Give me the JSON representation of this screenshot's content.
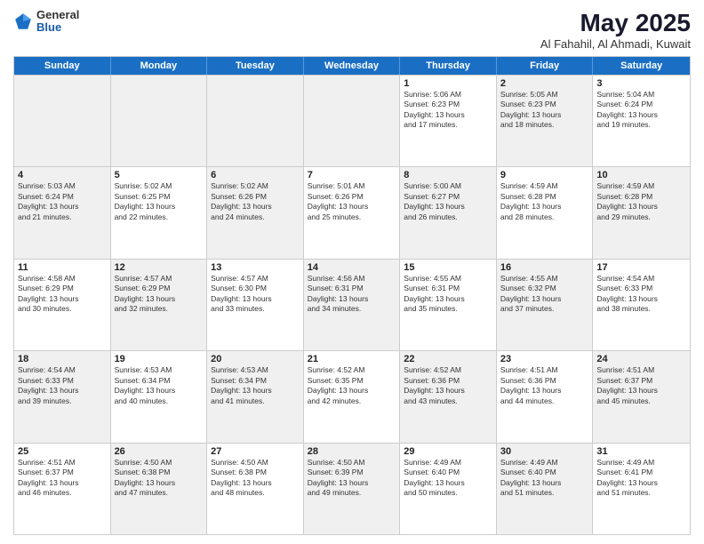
{
  "logo": {
    "general": "General",
    "blue": "Blue"
  },
  "title": "May 2025",
  "subtitle": "Al Fahahil, Al Ahmadi, Kuwait",
  "header_days": [
    "Sunday",
    "Monday",
    "Tuesday",
    "Wednesday",
    "Thursday",
    "Friday",
    "Saturday"
  ],
  "weeks": [
    [
      {
        "day": "",
        "text": "",
        "shaded": true
      },
      {
        "day": "",
        "text": "",
        "shaded": true
      },
      {
        "day": "",
        "text": "",
        "shaded": true
      },
      {
        "day": "",
        "text": "",
        "shaded": true
      },
      {
        "day": "1",
        "text": "Sunrise: 5:06 AM\nSunset: 6:23 PM\nDaylight: 13 hours\nand 17 minutes.",
        "shaded": false
      },
      {
        "day": "2",
        "text": "Sunrise: 5:05 AM\nSunset: 6:23 PM\nDaylight: 13 hours\nand 18 minutes.",
        "shaded": true
      },
      {
        "day": "3",
        "text": "Sunrise: 5:04 AM\nSunset: 6:24 PM\nDaylight: 13 hours\nand 19 minutes.",
        "shaded": false
      }
    ],
    [
      {
        "day": "4",
        "text": "Sunrise: 5:03 AM\nSunset: 6:24 PM\nDaylight: 13 hours\nand 21 minutes.",
        "shaded": true
      },
      {
        "day": "5",
        "text": "Sunrise: 5:02 AM\nSunset: 6:25 PM\nDaylight: 13 hours\nand 22 minutes.",
        "shaded": false
      },
      {
        "day": "6",
        "text": "Sunrise: 5:02 AM\nSunset: 6:26 PM\nDaylight: 13 hours\nand 24 minutes.",
        "shaded": true
      },
      {
        "day": "7",
        "text": "Sunrise: 5:01 AM\nSunset: 6:26 PM\nDaylight: 13 hours\nand 25 minutes.",
        "shaded": false
      },
      {
        "day": "8",
        "text": "Sunrise: 5:00 AM\nSunset: 6:27 PM\nDaylight: 13 hours\nand 26 minutes.",
        "shaded": true
      },
      {
        "day": "9",
        "text": "Sunrise: 4:59 AM\nSunset: 6:28 PM\nDaylight: 13 hours\nand 28 minutes.",
        "shaded": false
      },
      {
        "day": "10",
        "text": "Sunrise: 4:59 AM\nSunset: 6:28 PM\nDaylight: 13 hours\nand 29 minutes.",
        "shaded": true
      }
    ],
    [
      {
        "day": "11",
        "text": "Sunrise: 4:58 AM\nSunset: 6:29 PM\nDaylight: 13 hours\nand 30 minutes.",
        "shaded": false
      },
      {
        "day": "12",
        "text": "Sunrise: 4:57 AM\nSunset: 6:29 PM\nDaylight: 13 hours\nand 32 minutes.",
        "shaded": true
      },
      {
        "day": "13",
        "text": "Sunrise: 4:57 AM\nSunset: 6:30 PM\nDaylight: 13 hours\nand 33 minutes.",
        "shaded": false
      },
      {
        "day": "14",
        "text": "Sunrise: 4:56 AM\nSunset: 6:31 PM\nDaylight: 13 hours\nand 34 minutes.",
        "shaded": true
      },
      {
        "day": "15",
        "text": "Sunrise: 4:55 AM\nSunset: 6:31 PM\nDaylight: 13 hours\nand 35 minutes.",
        "shaded": false
      },
      {
        "day": "16",
        "text": "Sunrise: 4:55 AM\nSunset: 6:32 PM\nDaylight: 13 hours\nand 37 minutes.",
        "shaded": true
      },
      {
        "day": "17",
        "text": "Sunrise: 4:54 AM\nSunset: 6:33 PM\nDaylight: 13 hours\nand 38 minutes.",
        "shaded": false
      }
    ],
    [
      {
        "day": "18",
        "text": "Sunrise: 4:54 AM\nSunset: 6:33 PM\nDaylight: 13 hours\nand 39 minutes.",
        "shaded": true
      },
      {
        "day": "19",
        "text": "Sunrise: 4:53 AM\nSunset: 6:34 PM\nDaylight: 13 hours\nand 40 minutes.",
        "shaded": false
      },
      {
        "day": "20",
        "text": "Sunrise: 4:53 AM\nSunset: 6:34 PM\nDaylight: 13 hours\nand 41 minutes.",
        "shaded": true
      },
      {
        "day": "21",
        "text": "Sunrise: 4:52 AM\nSunset: 6:35 PM\nDaylight: 13 hours\nand 42 minutes.",
        "shaded": false
      },
      {
        "day": "22",
        "text": "Sunrise: 4:52 AM\nSunset: 6:36 PM\nDaylight: 13 hours\nand 43 minutes.",
        "shaded": true
      },
      {
        "day": "23",
        "text": "Sunrise: 4:51 AM\nSunset: 6:36 PM\nDaylight: 13 hours\nand 44 minutes.",
        "shaded": false
      },
      {
        "day": "24",
        "text": "Sunrise: 4:51 AM\nSunset: 6:37 PM\nDaylight: 13 hours\nand 45 minutes.",
        "shaded": true
      }
    ],
    [
      {
        "day": "25",
        "text": "Sunrise: 4:51 AM\nSunset: 6:37 PM\nDaylight: 13 hours\nand 46 minutes.",
        "shaded": false
      },
      {
        "day": "26",
        "text": "Sunrise: 4:50 AM\nSunset: 6:38 PM\nDaylight: 13 hours\nand 47 minutes.",
        "shaded": true
      },
      {
        "day": "27",
        "text": "Sunrise: 4:50 AM\nSunset: 6:38 PM\nDaylight: 13 hours\nand 48 minutes.",
        "shaded": false
      },
      {
        "day": "28",
        "text": "Sunrise: 4:50 AM\nSunset: 6:39 PM\nDaylight: 13 hours\nand 49 minutes.",
        "shaded": true
      },
      {
        "day": "29",
        "text": "Sunrise: 4:49 AM\nSunset: 6:40 PM\nDaylight: 13 hours\nand 50 minutes.",
        "shaded": false
      },
      {
        "day": "30",
        "text": "Sunrise: 4:49 AM\nSunset: 6:40 PM\nDaylight: 13 hours\nand 51 minutes.",
        "shaded": true
      },
      {
        "day": "31",
        "text": "Sunrise: 4:49 AM\nSunset: 6:41 PM\nDaylight: 13 hours\nand 51 minutes.",
        "shaded": false
      }
    ]
  ]
}
